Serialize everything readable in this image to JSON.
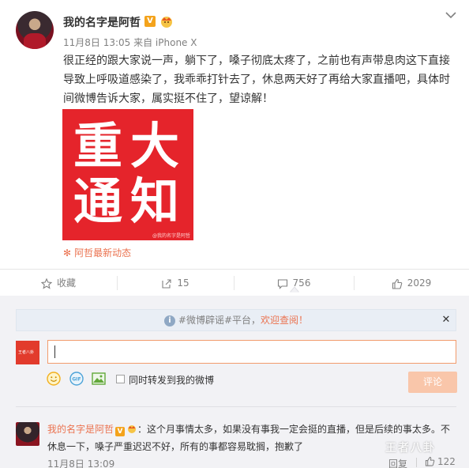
{
  "post": {
    "username": "我的名字是阿哲",
    "verified_badge": "V",
    "meta": "11月8日 13:05 来自 iPhone X",
    "content": "很正经的跟大家说一声，躺下了，嗓子彻底太疼了，之前也有声带息肉这下直接导致上呼吸道感染了，我乖乖打针去了，休息两天好了再给大家直播吧，具体时间微博告诉大家，属实挺不住了，望谅解！",
    "image": {
      "chars": [
        "重",
        "大",
        "通",
        "知"
      ],
      "watermark": "@我的名字是阿哲",
      "bg_color": "#e5242b"
    },
    "source_label": "阿哲最新动态",
    "icons": {
      "avatar": "avatar-image",
      "crown": "crown-icon",
      "more": "chevron-down-icon"
    }
  },
  "actions": {
    "favorite": {
      "label": "收藏",
      "icon": "star-icon"
    },
    "forward": {
      "count": "15",
      "icon": "share-icon"
    },
    "comment": {
      "count": "756",
      "icon": "comment-icon"
    },
    "like": {
      "count": "2029",
      "icon": "thumbs-up-icon"
    }
  },
  "comment_box": {
    "banner_prefix": "#微博辟谣#平台，",
    "banner_highlight": "欢迎查阅！",
    "input_value": "",
    "forward_label": "同时转发到我的微博",
    "submit_label": "评论",
    "mini_avatar_text": "王者八卦",
    "tools": [
      "emoji-icon",
      "gif-icon",
      "image-icon"
    ],
    "accent_color": "#eb7350"
  },
  "comments": [
    {
      "username": "我的名字是阿哲",
      "badge": "V",
      "text": "：这个月事情太多，如果没有事我一定会挺的直播，但是后续的事太多。不休息一下，嗓子严重迟迟不好，所有的事都容易耽搁，抱歉了",
      "time": "11月8日 13:09",
      "reply_label": "回复",
      "likes": "122"
    }
  ],
  "watermark_text": "王者八卦"
}
